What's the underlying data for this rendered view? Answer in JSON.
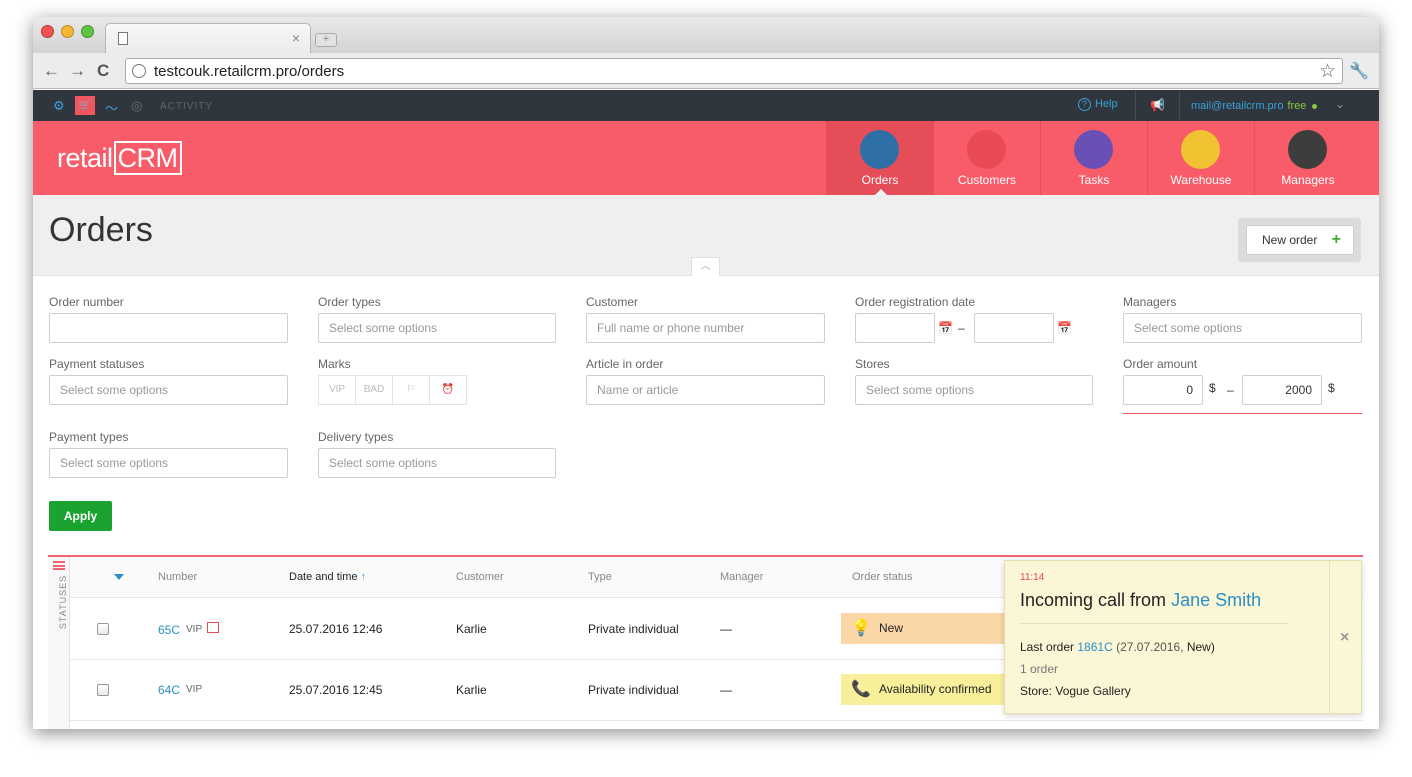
{
  "browser": {
    "url": "testcouk.retailcrm.pro/orders",
    "tab_close": "×",
    "new_tab": "+"
  },
  "appbar": {
    "activity_label": "ACTIVITY",
    "help_label": "Help",
    "email": "mail@retailcrm.pro",
    "plan": "free"
  },
  "header": {
    "logo_text": "retail",
    "logo_boxed": "CRM",
    "nav": [
      {
        "label": "Orders",
        "active": true,
        "color": "#2e6fa8"
      },
      {
        "label": "Customers",
        "active": false,
        "color": "#e84a56"
      },
      {
        "label": "Tasks",
        "active": false,
        "color": "#6a4fb5"
      },
      {
        "label": "Warehouse",
        "active": false,
        "color": "#f1c232"
      },
      {
        "label": "Managers",
        "active": false,
        "color": "#3d3d3d"
      }
    ]
  },
  "page": {
    "title": "Orders",
    "new_order_label": "New order"
  },
  "filters": {
    "order_number": {
      "label": "Order number",
      "value": ""
    },
    "order_types": {
      "label": "Order types",
      "placeholder": "Select some options"
    },
    "customer": {
      "label": "Customer",
      "placeholder": "Full name or phone number"
    },
    "reg_date": {
      "label": "Order registration date",
      "from": "",
      "to": "",
      "dash": "–"
    },
    "managers": {
      "label": "Managers",
      "placeholder": "Select some options"
    },
    "payment_statuses": {
      "label": "Payment statuses",
      "placeholder": "Select some options"
    },
    "marks": {
      "label": "Marks",
      "items": [
        "VIP",
        "BAD",
        "",
        ""
      ]
    },
    "article": {
      "label": "Article in order",
      "placeholder": "Name or article"
    },
    "stores": {
      "label": "Stores",
      "placeholder": "Select some options"
    },
    "order_amount": {
      "label": "Order amount",
      "from": "0",
      "to": "2000",
      "currency": "$",
      "dash": "–"
    },
    "payment_types": {
      "label": "Payment types",
      "placeholder": "Select some options"
    },
    "delivery_types": {
      "label": "Delivery types",
      "placeholder": "Select some options"
    },
    "apply_label": "Apply"
  },
  "table": {
    "statuses_label": "STATUSES",
    "headers": {
      "number": "Number",
      "date": "Date and time",
      "date_sort": "↑",
      "customer": "Customer",
      "type": "Type",
      "manager": "Manager",
      "status": "Order status"
    },
    "rows": [
      {
        "number": "65C",
        "vip": "VIP",
        "date": "25.07.2016 12:46",
        "customer": "Karlie",
        "type": "Private individual",
        "manager": "—",
        "status": "New",
        "status_color": "#fbd7a8"
      },
      {
        "number": "64C",
        "vip": "VIP",
        "date": "25.07.2016 12:45",
        "customer": "Karlie",
        "type": "Private individual",
        "manager": "—",
        "status": "Availability confirmed",
        "status_color": "#f7ef9a"
      }
    ]
  },
  "call_popup": {
    "time": "11:14",
    "title_prefix": "Incoming call from",
    "caller": "Jane Smith",
    "last_order_label": "Last order",
    "last_order_number": "1861C",
    "last_order_detail_open": "(27.07.2016,",
    "last_order_status": "New)",
    "order_count": "1 order",
    "store": "Store: Vogue Gallery",
    "close": "×"
  }
}
